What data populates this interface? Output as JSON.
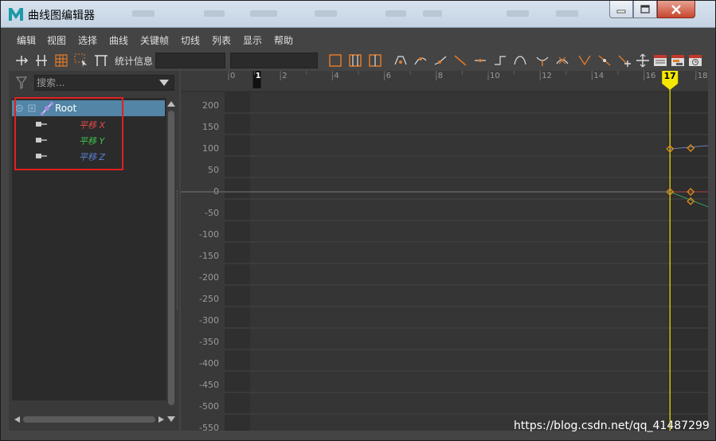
{
  "window": {
    "title": "曲线图编辑器"
  },
  "menu": [
    "编辑",
    "视图",
    "选择",
    "曲线",
    "关键帧",
    "切线",
    "列表",
    "显示",
    "帮助"
  ],
  "toolbar": {
    "stats_label": "统计信息"
  },
  "search": {
    "placeholder": "搜索..."
  },
  "outliner": {
    "root": "Root",
    "attributes": [
      {
        "label": "平移 X",
        "color": "#e24a4a"
      },
      {
        "label": "平移 Y",
        "color": "#3fc24e"
      },
      {
        "label": "平移 Z",
        "color": "#5a7fd6"
      }
    ]
  },
  "timeline": {
    "ticks": [
      "0",
      "1",
      "2",
      "4",
      "6",
      "8",
      "10",
      "12",
      "14",
      "16",
      "17",
      "18"
    ],
    "current_frame": "17"
  },
  "value_axis": [
    "200",
    "150",
    "100",
    "50",
    "0",
    "-50",
    "-100",
    "-150",
    "-200",
    "-250",
    "-300",
    "-350",
    "-400",
    "-450",
    "-500",
    "-550"
  ],
  "colors": {
    "accent": "#5285a6",
    "playhead": "#f5e800",
    "keyframe": "#d98a1a",
    "highlight": "#e02020"
  },
  "watermark": "https://blog.csdn.net/qq_41487299"
}
